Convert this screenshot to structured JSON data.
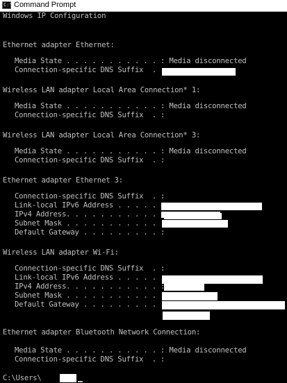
{
  "window": {
    "title": "Command Prompt",
    "icon": "cmd-icon",
    "icon_glyph": "C:\\"
  },
  "console": {
    "lines": [
      {
        "text": "Windows IP Configuration",
        "indent": 0
      },
      {
        "text": "Ethernet adapter Ethernet:",
        "indent": 0
      },
      {
        "text": "Media State . . . . . . . . . . . : Media disconnected",
        "indent": 1
      },
      {
        "text": "Connection-specific DNS Suffix  . :",
        "indent": 1
      },
      {
        "text": "Wireless LAN adapter Local Area Connection* 1:",
        "indent": 0
      },
      {
        "text": "Media State . . . . . . . . . . . : Media disconnected",
        "indent": 1
      },
      {
        "text": "Connection-specific DNS Suffix  . :",
        "indent": 1
      },
      {
        "text": "Wireless LAN adapter Local Area Connection* 3:",
        "indent": 0
      },
      {
        "text": "Media State . . . . . . . . . . . : Media disconnected",
        "indent": 1
      },
      {
        "text": "Connection-specific DNS Suffix  . :",
        "indent": 1
      },
      {
        "text": "Ethernet adapter Ethernet 3:",
        "indent": 0
      },
      {
        "text": "Connection-specific DNS Suffix  . :",
        "indent": 1
      },
      {
        "text": "Link-local IPv6 Address . . . . . :",
        "indent": 1
      },
      {
        "text": "IPv4 Address. . . . . . . . . . . :",
        "indent": 1
      },
      {
        "text": "Subnet Mask . . . . . . . . . . . :",
        "indent": 1
      },
      {
        "text": "Default Gateway . . . . . . . . . :",
        "indent": 1
      },
      {
        "text": "Wireless LAN adapter Wi-Fi:",
        "indent": 0
      },
      {
        "text": "Connection-specific DNS Suffix  . :",
        "indent": 1
      },
      {
        "text": "Link-local IPv6 Address . . . . . :",
        "indent": 1
      },
      {
        "text": "IPv4 Address. . . . . . . . . . . :",
        "indent": 1
      },
      {
        "text": "Subnet Mask . . . . . . . . . . . :",
        "indent": 1
      },
      {
        "text": "Default Gateway . . . . . . . . . :",
        "indent": 1
      },
      {
        "text": "Ethernet adapter Bluetooth Network Connection:",
        "indent": 0
      },
      {
        "text": "Media State . . . . . . . . . . . : Media disconnected",
        "indent": 1
      },
      {
        "text": "Connection-specific DNS Suffix  . :",
        "indent": 1
      },
      {
        "text": "C:\\Users\\",
        "indent": 0
      }
    ]
  },
  "colors": {
    "background": "#000000",
    "text": "#c0c0c0",
    "redaction": "#ffffff"
  }
}
